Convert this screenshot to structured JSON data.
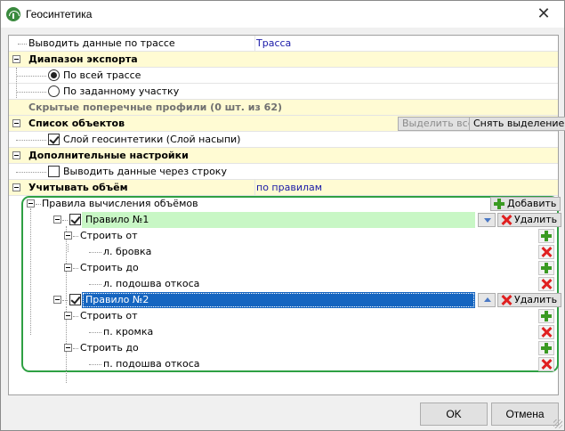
{
  "window": {
    "title": "Геосинтетика",
    "close_glyph": "✕"
  },
  "props": {
    "output_by_route": {
      "label": "Выводить данные по трассе",
      "value": "Трасса"
    },
    "export_range": {
      "label": "Диапазон экспорта",
      "options": [
        {
          "label": "По всей трассе",
          "selected": true
        },
        {
          "label": "По заданному участку",
          "selected": false
        }
      ]
    },
    "hidden_profiles": {
      "label": "Скрытые поперечные профили (0 шт. из 62)"
    },
    "object_list": {
      "label": "Список объектов",
      "select_all": "Выделить все",
      "deselect": "Снять выделение",
      "item": {
        "label": "Слой геосинтетики (Слой насыпи)",
        "checked": true
      }
    },
    "extra": {
      "label": "Дополнительные настройки",
      "item": {
        "label": "Выводить данные через строку",
        "checked": false
      }
    },
    "volume": {
      "label": "Учитывать объём",
      "value": "по правилам",
      "rules_label": "Правила вычисления объёмов",
      "add_label": "Добавить",
      "rules": [
        {
          "name": "Правило №1",
          "checked": true,
          "delete_label": "Удалить",
          "build_from": "Строить от",
          "from_value": "л. бровка",
          "build_to": "Строить до",
          "to_value": "л. подошва откоса"
        },
        {
          "name": "Правило №2",
          "checked": true,
          "delete_label": "Удалить",
          "build_from": "Строить от",
          "from_value": "п. кромка",
          "build_to": "Строить до",
          "to_value": "п. подошва откоса"
        }
      ]
    }
  },
  "footer": {
    "ok": "OK",
    "cancel": "Отмена"
  },
  "colors": {
    "category_bg": "#fffbd3",
    "rule1_bg": "#c8f7c5",
    "rule2_selected_bg": "#1565c0",
    "rules_border": "#2ea043",
    "value_text": "#1a1aa8"
  }
}
